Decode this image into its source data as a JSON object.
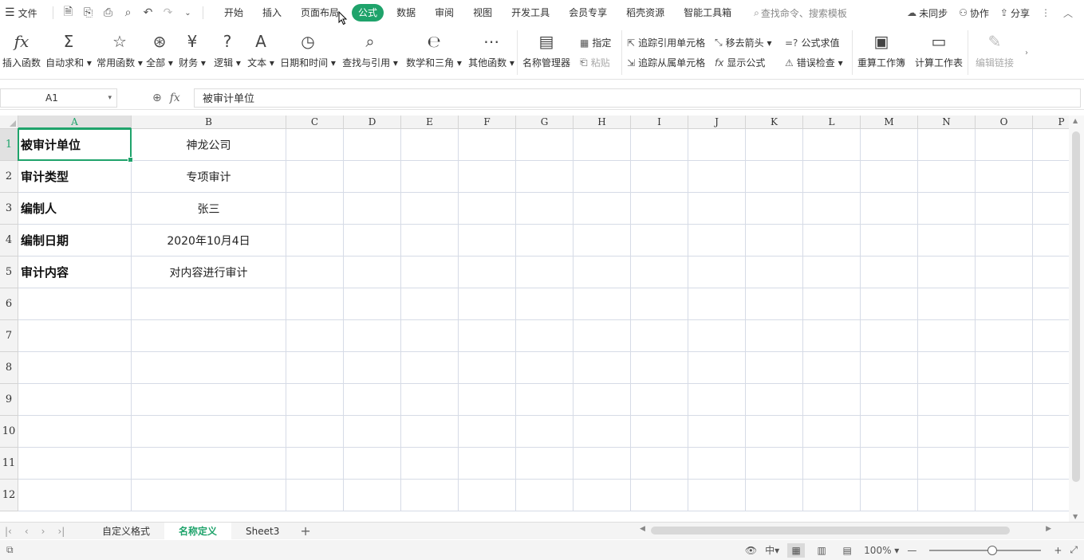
{
  "menubar": {
    "file_label": "文件",
    "quick_access": [
      "save-icon",
      "save-as-icon",
      "print-icon",
      "print-preview-icon",
      "undo-icon",
      "redo-icon",
      "more-dropdown-icon"
    ],
    "tabs": [
      "开始",
      "插入",
      "页面布局",
      "公式",
      "数据",
      "审阅",
      "视图",
      "开发工具",
      "会员专享",
      "稻壳资源",
      "智能工具箱"
    ],
    "active_tab": "公式",
    "search_placeholder": "查找命令、搜索模板",
    "right": {
      "sync": "未同步",
      "collab": "协作",
      "share": "分享"
    }
  },
  "ribbon": {
    "insert_function": "插入函数",
    "autosum": "自动求和",
    "common_functions": "常用函数",
    "all": "全部",
    "finance": "财务",
    "logic": "逻辑",
    "text": "文本",
    "datetime": "日期和时间",
    "lookup": "查找与引用",
    "math": "数学和三角",
    "other": "其他函数",
    "name_manager": "名称管理器",
    "specify": "指定",
    "paste": "粘贴",
    "trace_precedents": "追踪引用单元格",
    "trace_dependents": "追踪从属单元格",
    "remove_arrows": "移去箭头",
    "show_formulas": "显示公式",
    "evaluate_formula": "公式求值",
    "error_checking": "错误检查",
    "recalc_workbook": "重算工作簿",
    "calc_sheet": "计算工作表",
    "edit_links": "编辑链接"
  },
  "formula_bar": {
    "name_box": "A1",
    "content": "被审计单位"
  },
  "grid": {
    "columns": [
      "A",
      "B",
      "C",
      "D",
      "E",
      "F",
      "G",
      "H",
      "I",
      "J",
      "K",
      "L",
      "M",
      "N",
      "O",
      "P"
    ],
    "rows": [
      "1",
      "2",
      "3",
      "4",
      "5",
      "6",
      "7",
      "8",
      "9",
      "10",
      "11",
      "12"
    ],
    "data": [
      [
        "被审计单位",
        "神龙公司"
      ],
      [
        "审计类型",
        "专项审计"
      ],
      [
        "编制人",
        "张三"
      ],
      [
        "编制日期",
        "2020年10月4日"
      ],
      [
        "审计内容",
        "对内容进行审计"
      ]
    ],
    "selected_cell": "A1"
  },
  "sheets": {
    "tabs": [
      "自定义格式",
      "名称定义",
      "Sheet3"
    ],
    "active": "名称定义"
  },
  "status": {
    "zoom": "100%",
    "zoom_fraction": 0.5
  },
  "colors": {
    "accent": "#1fa36b",
    "gridline": "#d6dbe6"
  }
}
